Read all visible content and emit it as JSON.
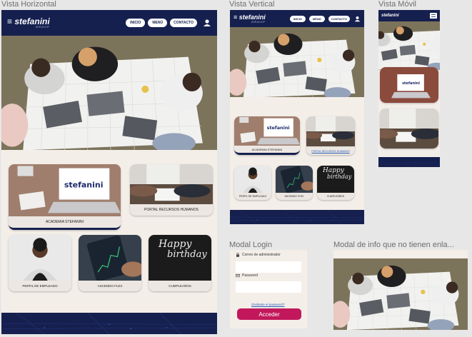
{
  "frames": {
    "horizontal": {
      "label": "Vista Horizontal"
    },
    "vertical": {
      "label": "Vista Vertical"
    },
    "mobile": {
      "label": "Vista Móvil"
    },
    "login": {
      "label": "Modal Login"
    },
    "info_modal": {
      "label": "Modal  de info que no tienen enla..."
    }
  },
  "brand": {
    "name": "stefanini",
    "sub": "GROUP",
    "navy": "#16204f",
    "accent": "#c2185b"
  },
  "nav": {
    "inicio": "INICIO",
    "menu": "MENÚ",
    "contacto": "CONTACTO",
    "user_icon": "user-icon"
  },
  "cards": {
    "academia": "ACADEMIA STEFANINI",
    "portal": "PORTAL RECURSOS HUMANOS",
    "perfil": "PERFIL DE EMPLEADO",
    "ascendo": "ASCENDO FLEX",
    "cumple": "CUMPLEAÑOS"
  },
  "login": {
    "email_label": "Correo de administrador",
    "password_label": "Password",
    "forgot": "Olvidaste el password?",
    "submit": "Acceder"
  },
  "birthday_art": {
    "line1": "Happy",
    "line2": "birthday"
  }
}
